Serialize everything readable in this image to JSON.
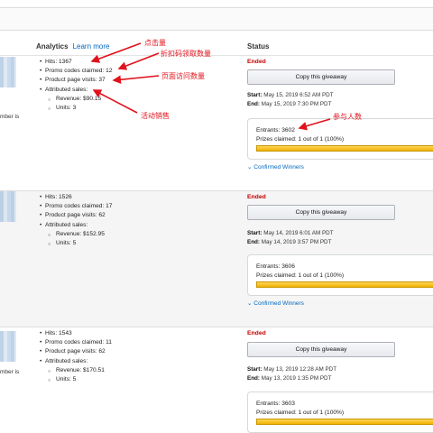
{
  "header": {
    "analytics_label": "Analytics",
    "learn_more_label": "Learn more",
    "status_label": "Status"
  },
  "member_text": "mber is",
  "rows": [
    {
      "stats": {
        "hits": "Hits: 1367",
        "promo": "Promo codes claimed: 12",
        "visits": "Product page visits: 37",
        "sales": "Attributed sales:",
        "revenue": "Revenue: $90.15",
        "units": "Units: 3"
      },
      "status": "Ended",
      "copy_label": "Copy this giveaway",
      "start": "May 15, 2019 6:52 AM PDT",
      "end": "May 15, 2019 7:30 PM PDT",
      "entrants": "Entrants: 3602",
      "prizes": "Prizes claimed: 1 out of 1 (100%)",
      "prizes_pct": 100,
      "confirmed_label": "Confirmed Winners"
    },
    {
      "stats": {
        "hits": "Hits: 1526",
        "promo": "Promo codes claimed: 17",
        "visits": "Product page visits: 62",
        "sales": "Attributed sales:",
        "revenue": "Revenue: $152.95",
        "units": "Units: 5"
      },
      "status": "Ended",
      "copy_label": "Copy this giveaway",
      "start": "May 14, 2019 6:01 AM PDT",
      "end": "May 14, 2019 3:57 PM PDT",
      "entrants": "Entrants: 3606",
      "prizes": "Prizes claimed: 1 out of 1 (100%)",
      "prizes_pct": 100,
      "confirmed_label": "Confirmed Winners"
    },
    {
      "stats": {
        "hits": "Hits: 1543",
        "promo": "Promo codes claimed: 11",
        "visits": "Product page visits: 62",
        "sales": "Attributed sales:",
        "revenue": "Revenue: $170.51",
        "units": "Units: 5"
      },
      "status": "Ended",
      "copy_label": "Copy this giveaway",
      "start": "May 13, 2019 12:28 AM PDT",
      "end": "May 13, 2019 1:35 PM PDT",
      "entrants": "Entrants: 3603",
      "prizes": "Prizes claimed: 1 out of 1 (100%)",
      "prizes_pct": 100
    }
  ],
  "labels": {
    "start": "Start:",
    "end": "End:"
  },
  "annotations": {
    "clicks": "点击量",
    "promo": "折扣码领取数量",
    "visits": "页面访问数量",
    "sales": "活动销售",
    "entrants": "参与人数"
  },
  "colors": {
    "annotation": "#e0121b",
    "ended": "#c40000",
    "link": "#0066c0",
    "progress": "#f0b200"
  }
}
